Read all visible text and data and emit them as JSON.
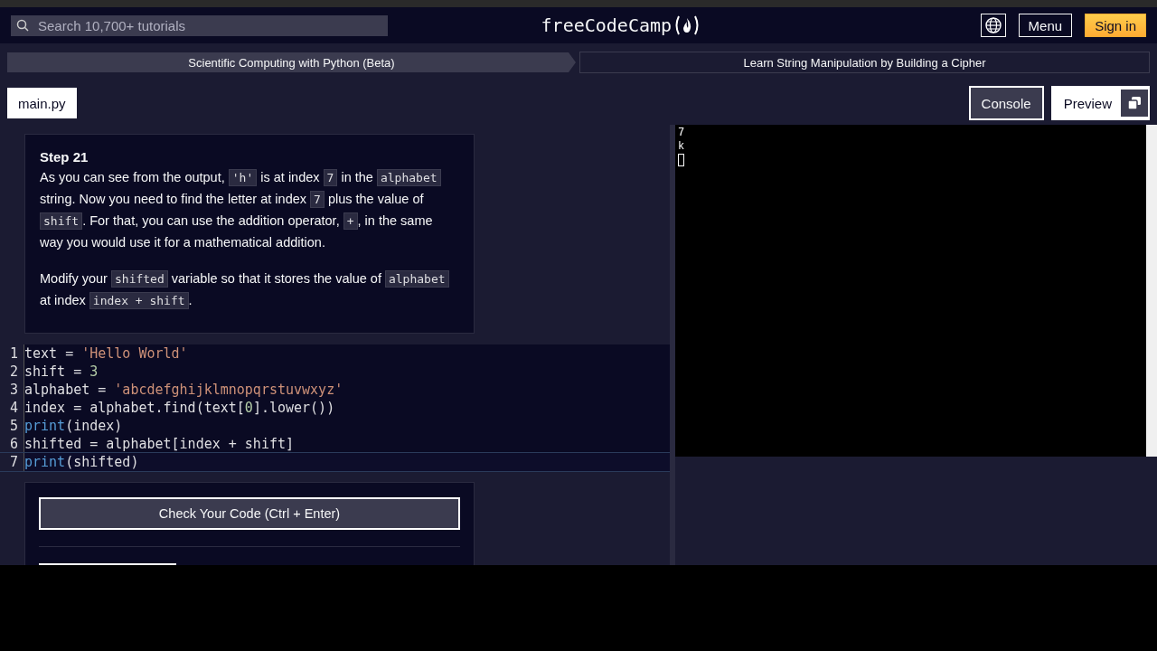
{
  "header": {
    "search": {
      "placeholder": "Search 10,700+ tutorials"
    },
    "logo": "freeCodeCamp",
    "menu": "Menu",
    "sign_in": "Sign in"
  },
  "breadcrumbs": [
    "Scientific Computing with Python (Beta)",
    "Learn String Manipulation by Building a Cipher"
  ],
  "file_tab": "main.py",
  "panel_tabs": [
    {
      "label": "Console",
      "selected": true
    },
    {
      "label": "Preview",
      "selected": false
    }
  ],
  "step": {
    "title": "Step 21",
    "paragraphs": [
      [
        {
          "kind": "text",
          "text": "As you can see from the output, "
        },
        {
          "kind": "code",
          "text": "'h'"
        },
        {
          "kind": "text",
          "text": " is at index "
        },
        {
          "kind": "code",
          "text": "7"
        },
        {
          "kind": "text",
          "text": " in the "
        },
        {
          "kind": "code",
          "text": "alphabet"
        },
        {
          "kind": "text",
          "text": " string. Now you need to find the letter at index "
        },
        {
          "kind": "code",
          "text": "7"
        },
        {
          "kind": "text",
          "text": " plus the value of "
        },
        {
          "kind": "code",
          "text": "shift"
        },
        {
          "kind": "text",
          "text": ". For that, you can use the addition operator, "
        },
        {
          "kind": "code",
          "text": "+"
        },
        {
          "kind": "text",
          "text": ", in the same way you would use it for a mathematical addition."
        }
      ],
      [
        {
          "kind": "text",
          "text": "Modify your "
        },
        {
          "kind": "code",
          "text": "shifted"
        },
        {
          "kind": "text",
          "text": " variable so that it stores the value of "
        },
        {
          "kind": "code",
          "text": "alphabet"
        },
        {
          "kind": "text",
          "text": " at index "
        },
        {
          "kind": "code",
          "text": "index + shift"
        },
        {
          "kind": "text",
          "text": "."
        }
      ]
    ]
  },
  "editor": {
    "lines": [
      {
        "number": "1",
        "active": false,
        "tokens": [
          {
            "kind": "plain",
            "text": "text = "
          },
          {
            "kind": "string",
            "text": "'Hello World'"
          }
        ]
      },
      {
        "number": "2",
        "active": false,
        "tokens": [
          {
            "kind": "plain",
            "text": "shift = "
          },
          {
            "kind": "number",
            "text": "3"
          }
        ]
      },
      {
        "number": "3",
        "active": false,
        "tokens": [
          {
            "kind": "plain",
            "text": "alphabet = "
          },
          {
            "kind": "string",
            "text": "'abcdefghijklmnopqrstuvwxyz'"
          }
        ]
      },
      {
        "number": "4",
        "active": false,
        "tokens": [
          {
            "kind": "plain",
            "text": "index = alphabet.find(text["
          },
          {
            "kind": "number",
            "text": "0"
          },
          {
            "kind": "plain",
            "text": "].lower())"
          }
        ]
      },
      {
        "number": "5",
        "active": false,
        "tokens": [
          {
            "kind": "keyword",
            "text": "print"
          },
          {
            "kind": "plain",
            "text": "(index)"
          }
        ]
      },
      {
        "number": "6",
        "active": false,
        "tokens": [
          {
            "kind": "plain",
            "text": "shifted = alphabet[index + shift]"
          }
        ]
      },
      {
        "number": "7",
        "active": true,
        "tokens": [
          {
            "kind": "keyword",
            "text": "print"
          },
          {
            "kind": "plain",
            "text": "(shifted)"
          }
        ]
      }
    ]
  },
  "check_button": "Check Your Code (Ctrl + Enter)",
  "console": {
    "lines": [
      "7",
      "k"
    ]
  }
}
